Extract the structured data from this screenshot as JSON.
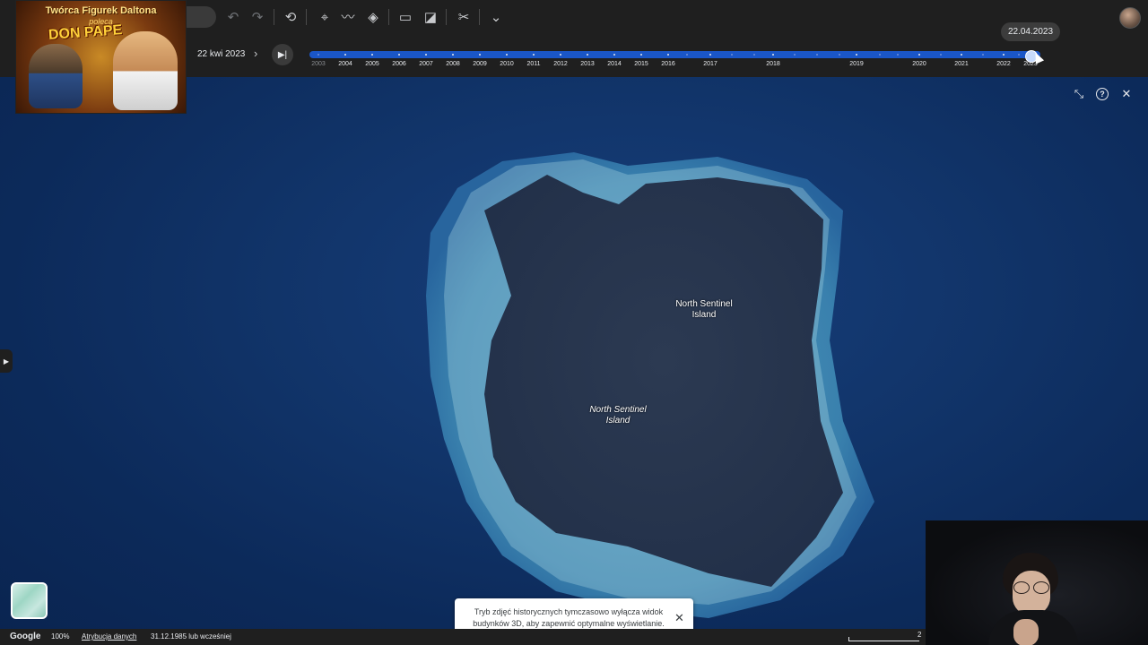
{
  "map": {
    "labels": [
      {
        "text": "North Sentinel Island",
        "line1": "North Sentinel",
        "line2": "Island"
      },
      {
        "text": "North Sentinel Island",
        "line1": "North Sentinel",
        "line2": "Island"
      }
    ]
  },
  "toolbar": {
    "icons": [
      "undo-icon",
      "redo-icon",
      "historical-imagery-icon",
      "placemark-icon",
      "path-icon",
      "layers-icon",
      "ruler-icon",
      "chart-icon",
      "satellite-icon",
      "chevron-down-icon"
    ]
  },
  "timeline": {
    "date_label": "22 kwi 2023",
    "tooltip": "22.04.2023",
    "years": [
      "2003",
      "2004",
      "2005",
      "2006",
      "2007",
      "2008",
      "2009",
      "2010",
      "2011",
      "2012",
      "2013",
      "2014",
      "2015",
      "2016",
      "2017",
      "2018",
      "2019",
      "2020",
      "2021",
      "2022",
      "2023"
    ],
    "selected_year": "2023",
    "selected_position": 0.985
  },
  "overlay_ad": {
    "title": "Twórca Figurek Daltona",
    "subtitle": "poleca",
    "brand": "DON PAPE"
  },
  "toast": {
    "message": "Tryb zdjęć historycznych tymczasowo wyłącza widok budynków 3D, aby zapewnić optymalne wyświetlanie.",
    "close": "✕"
  },
  "status_bar": {
    "brand": "Google",
    "zoom": "100%",
    "attribution": "Atrybucja danych",
    "imagery_date": "31.12.1985 lub wcześniej",
    "scale": "2 "
  },
  "colors": {
    "accent": "#1a56c7",
    "toolbar_bg": "#1f1f1f",
    "ocean": "#113469"
  }
}
